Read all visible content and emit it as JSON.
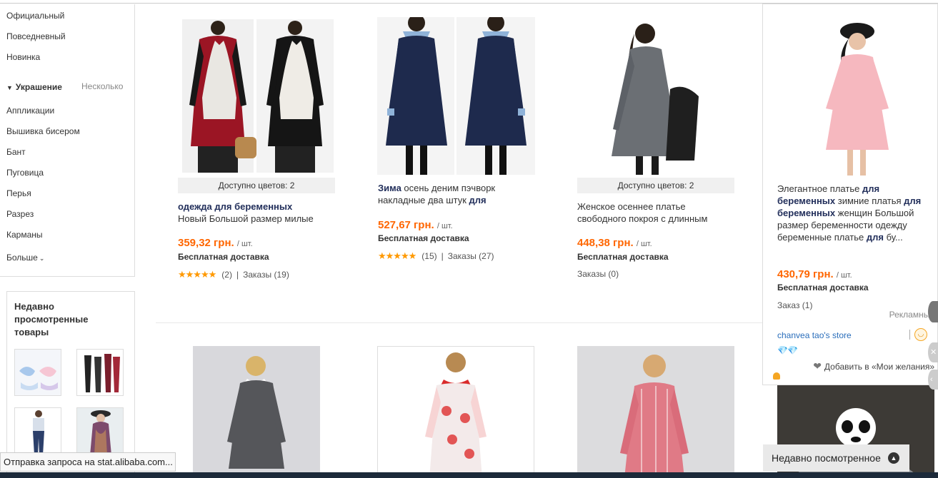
{
  "sidebar": {
    "style_links": [
      "Официальный",
      "Повседневный",
      "Новинка"
    ],
    "decoration_heading": "Украшение",
    "multiple_label": "Несколько",
    "decoration_links": [
      "Аппликации",
      "Вышивка бисером",
      "Бант",
      "Пуговица",
      "Перья",
      "Разрез",
      "Карманы"
    ],
    "more_label": "Больше"
  },
  "recently_viewed": {
    "title": "Недавно просмотренные товары"
  },
  "products": [
    {
      "colors_label": "Доступно цветов: 2",
      "title_bold": "одежда для беременных",
      "title_rest": "Новый Большой размер милые",
      "price": "359,32 грн.",
      "unit": "/ шт.",
      "shipping": "Бесплатная доставка",
      "stars": "★★★★★",
      "rating_count": "(2)",
      "orders": "Заказы (19)"
    },
    {
      "colors_label": "",
      "title_bold": "Зима",
      "title_rest": " осень деним пэчворк накладные два штук ",
      "title_bold2": "для",
      "price": "527,67 грн.",
      "unit": "/ шт.",
      "shipping": "Бесплатная доставка",
      "stars": "★★★★★",
      "rating_count": "(15)",
      "orders": "Заказы (27)"
    },
    {
      "colors_label": "Доступно цветов: 2",
      "title_rest": "Женское осеннее платье свободного покроя с длинным",
      "price": "448,38 грн.",
      "unit": "/ шт.",
      "shipping": "Бесплатная доставка",
      "orders": "Заказы (0)"
    }
  ],
  "featured": {
    "t1": "Элегантное платье ",
    "t2": "для",
    "t3": "беременных",
    "t4": " зимние платья ",
    "t5": "для беременных",
    "t6": " женщин Большой размер беременности одежду беременные платье ",
    "t7": "для",
    "t8": " бу...",
    "price": "430,79 грн.",
    "unit": "/ шт.",
    "shipping": "Бесплатная доставка",
    "orders": "Заказ (1)",
    "ad_label": "Рекламные",
    "store": "chanvea tao's store",
    "diamonds": "💎💎",
    "wishlist": "Добавить в «Мои желания»"
  },
  "status_text": "Отправка запроса на stat.alibaba.com...",
  "recent_bar_label": "Недавно посмотренное",
  "colors": {
    "price": "#ff6600",
    "title_bold": "#222f5b",
    "store_link": "#2a6ebb",
    "star": "#ff9900"
  }
}
